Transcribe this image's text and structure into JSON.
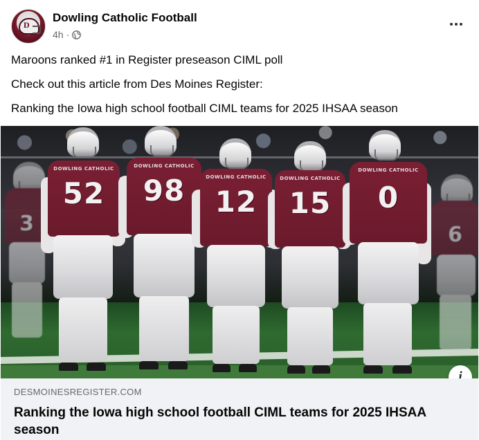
{
  "post": {
    "page_name": "Dowling Catholic Football",
    "timestamp": "4h",
    "separator": "·",
    "privacy_icon": "globe-icon",
    "more_icon": "more-options-icon",
    "avatar_letter": "D",
    "body_lines": [
      "Maroons ranked #1 in Register preseason CIML poll",
      "Check out this article from Des Moines Register:",
      "Ranking the Iowa high school football CIML teams for 2025 IHSAA season"
    ]
  },
  "photo": {
    "jersey_school": "DOWLING CATHOLIC",
    "players": [
      {
        "number": "3"
      },
      {
        "number": "52"
      },
      {
        "number": "98"
      },
      {
        "number": "12"
      },
      {
        "number": "15"
      },
      {
        "number": "0"
      },
      {
        "number": "6"
      }
    ],
    "colors": {
      "maroon": "#7b1f33",
      "white": "#f2f2f3",
      "turf": "#2f6a30"
    }
  },
  "link": {
    "domain": "DESMOINESREGISTER.COM",
    "title": "Ranking the Iowa high school football CIML teams for 2025 IHSAA season",
    "info_icon": "info-icon",
    "info_glyph": "i"
  }
}
